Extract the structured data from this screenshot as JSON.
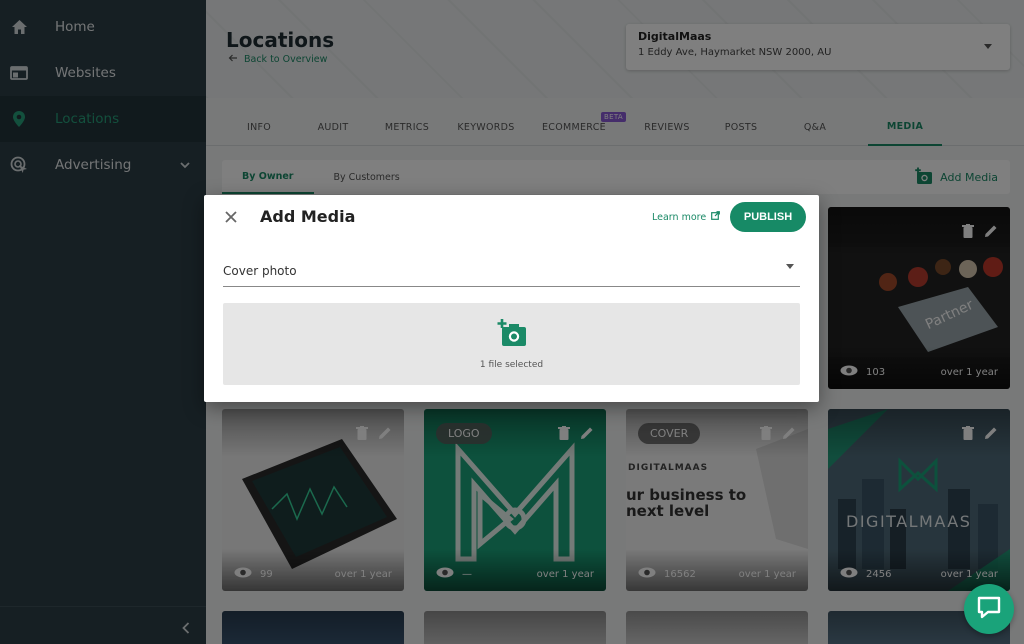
{
  "sidebar": {
    "items": [
      {
        "label": "Home",
        "icon": "home-icon"
      },
      {
        "label": "Websites",
        "icon": "website-icon"
      },
      {
        "label": "Locations",
        "icon": "location-pin-icon"
      },
      {
        "label": "Advertising",
        "icon": "target-icon"
      }
    ]
  },
  "header": {
    "title": "Locations",
    "back_label": "Back to Overview",
    "location_name": "DigitalMaas",
    "location_address": "1 Eddy Ave, Haymarket NSW 2000, AU"
  },
  "tabs": [
    "INFO",
    "AUDIT",
    "METRICS",
    "KEYWORDS",
    "ECOMMERCE",
    "REVIEWS",
    "POSTS",
    "Q&A",
    "MEDIA"
  ],
  "beta_label": "BETA",
  "subtabs": [
    "By Owner",
    "By Customers"
  ],
  "add_media_label": "Add Media",
  "cards": [
    {
      "views": "103",
      "age": "over 1 year",
      "badge": ""
    },
    {
      "views": "99",
      "age": "over 1 year",
      "badge": ""
    },
    {
      "views": "—",
      "age": "over 1 year",
      "badge": "LOGO"
    },
    {
      "views": "16562",
      "age": "over 1 year",
      "badge": "COVER"
    },
    {
      "views": "2456",
      "age": "over 1 year",
      "badge": ""
    }
  ],
  "card_texts": {
    "partner": "Partner",
    "cover_brand": "DIGITALMAAS",
    "cover_line1": "ur business to",
    "cover_line2": "next level",
    "brand_word": "DIGITALMAAS"
  },
  "modal": {
    "title": "Add Media",
    "learn_more": "Learn more",
    "publish": "PUBLISH",
    "category": "Cover photo",
    "file_status": "1 file selected"
  },
  "colors": {
    "accent": "#1b8a67",
    "sidebar": "#2c3e46",
    "beta": "#8a5bd6"
  }
}
